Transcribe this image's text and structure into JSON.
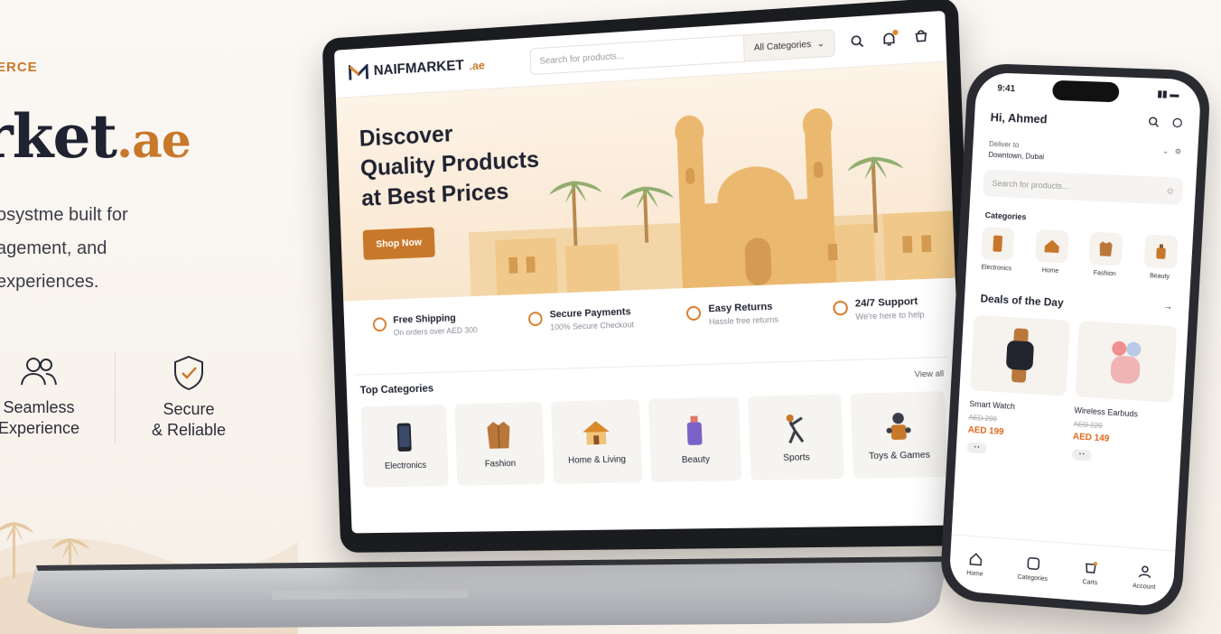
{
  "hero": {
    "kicker": "ERCE",
    "title_main": "rket",
    "title_tld": ".ae",
    "desc_line1": "osystme built for",
    "desc_line2": "agement, and",
    "desc_line3": "experiences.",
    "features": [
      {
        "icon": "users-icon",
        "line1": "Seamless",
        "line2": "Experience"
      },
      {
        "icon": "shield-check-icon",
        "line1": "Secure",
        "line2": "& Reliable"
      }
    ]
  },
  "laptop": {
    "logo": {
      "name": "NAIFMARKET",
      "tld": ".ae"
    },
    "search": {
      "placeholder": "Search for products...",
      "category": "All Categories"
    },
    "banner": {
      "line1": "Discover",
      "line2": "Quality Products",
      "line3": "at Best Prices",
      "cta": "Shop Now"
    },
    "perks": [
      {
        "title": "Free Shipping",
        "sub": "On orders over AED 300"
      },
      {
        "title": "Secure Payments",
        "sub": "100% Secure Checkout"
      },
      {
        "title": "Easy Returns",
        "sub": "Hassle free returns"
      },
      {
        "title": "24/7 Support",
        "sub": "We're here to help"
      }
    ],
    "top_categories": {
      "title": "Top Categories",
      "view_all": "View all",
      "items": [
        "Electronics",
        "Fashion",
        "Home & Living",
        "Beauty",
        "Sports",
        "Toys & Games"
      ]
    }
  },
  "phone": {
    "time": "9:41",
    "greeting": "Hi, Ahmed",
    "deliver_label": "Deliver to",
    "deliver_location": "Downtown, Dubai",
    "search_placeholder": "Search for products...",
    "categories_title": "Categories",
    "categories": [
      "Electronics",
      "Home",
      "Fashion",
      "Beauty"
    ],
    "deals_title": "Deals of the Day",
    "deals": [
      {
        "name": "Smart Watch",
        "old_price": "AED 299",
        "price": "AED 199"
      },
      {
        "name": "Wireless Earbuds",
        "old_price": "AED 229",
        "price": "AED 149"
      }
    ],
    "nav": [
      "Home",
      "Categories",
      "Carts",
      "Account"
    ]
  },
  "colors": {
    "accent": "#c8782a",
    "price": "#e0661c",
    "banner": "#f8e5cd"
  }
}
